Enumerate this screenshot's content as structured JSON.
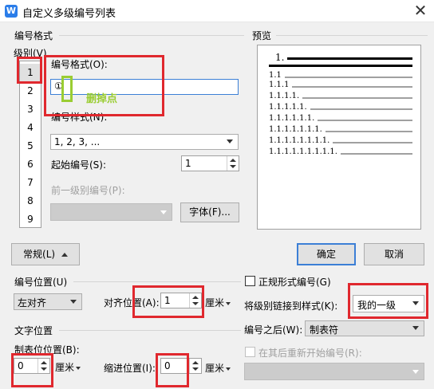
{
  "window": {
    "title": "自定义多级编号列表",
    "close_symbol": "✕",
    "app_icon_letter": "W"
  },
  "format_group": {
    "label": "编号格式"
  },
  "level": {
    "label": "级别(V)",
    "items": [
      "1",
      "2",
      "3",
      "4",
      "5",
      "6",
      "7",
      "8",
      "9"
    ],
    "selected": "1"
  },
  "number_format": {
    "label": "编号格式(O):",
    "value": "①"
  },
  "annotation": {
    "text": "删掉点",
    "color": "#9acd32"
  },
  "number_style": {
    "label": "编号样式(N):",
    "value": "1, 2, 3, ..."
  },
  "start_at": {
    "label": "起始编号(S):",
    "value": "1"
  },
  "prev_level": {
    "label": "前一级别编号(P):"
  },
  "font_button": {
    "label": "字体(F)..."
  },
  "preview": {
    "label": "预览",
    "lines": [
      "1.",
      "1.1",
      "1.1.1",
      "1.1.1.1.",
      "1.1.1.1.1.",
      "1.1.1.1.1.1.",
      "1.1.1.1.1.1.1.",
      "1.1.1.1.1.1.1.1.",
      "1.1.1.1.1.1.1.1.1."
    ]
  },
  "normal_button": {
    "label": "常规(L)",
    "icon": "chevron-up-icon"
  },
  "ok_button": {
    "label": "确定"
  },
  "cancel_button": {
    "label": "取消"
  },
  "number_position": {
    "label": "编号位置(U)",
    "alignment": "左对齐",
    "align_at_label": "对齐位置(A):",
    "align_at_value": "1",
    "unit": "厘米"
  },
  "text_position": {
    "label": "文字位置",
    "tab_label": "制表位位置(B):",
    "tab_value": "0",
    "tab_unit": "厘米",
    "indent_label": "缩进位置(I):",
    "indent_value": "0",
    "indent_unit": "厘米"
  },
  "legal_style": {
    "label": "正规形式编号(G)",
    "checked": false
  },
  "link_style": {
    "label": "将级别链接到样式(K):",
    "value": "我的一级"
  },
  "follow_number": {
    "label": "编号之后(W):",
    "value": "制表符"
  },
  "restart": {
    "label": "在其后重新开始编号(R):",
    "checked": false
  },
  "highlight_color": "#e0282e"
}
